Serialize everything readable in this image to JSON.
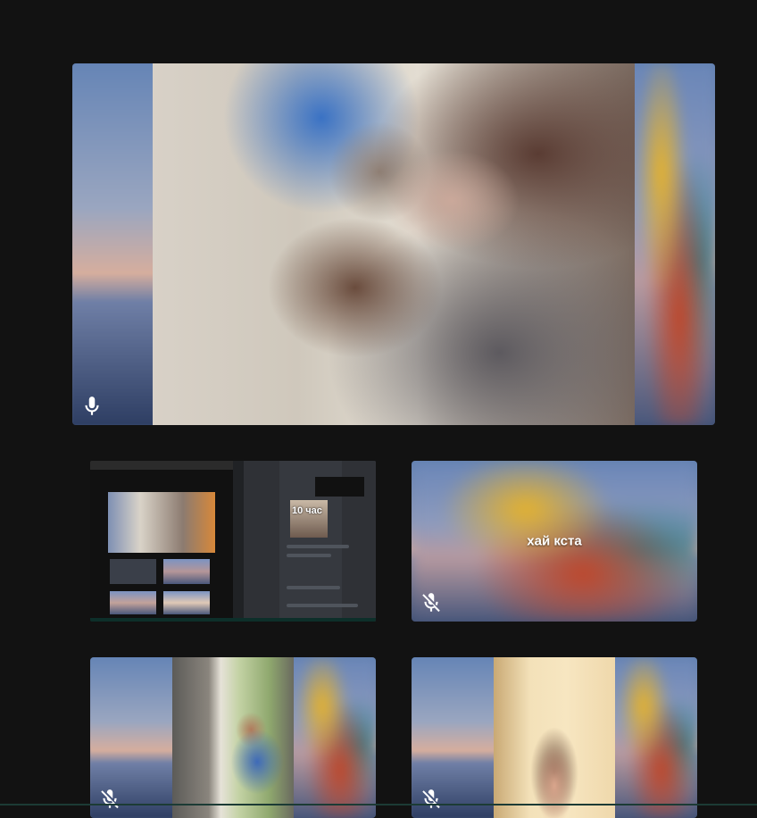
{
  "tiles": {
    "main": {
      "mic": "mic-on-icon"
    },
    "screen_share": {
      "mic": "none",
      "overlay_text": "10 час"
    },
    "participant_2": {
      "name": "хай кста",
      "mic": "mic-off-icon"
    },
    "participant_3": {
      "mic": "mic-off-icon"
    },
    "participant_4": {
      "mic": "mic-off-icon"
    }
  },
  "colors": {
    "background": "#121212",
    "mic_icon": "#ffffff"
  }
}
